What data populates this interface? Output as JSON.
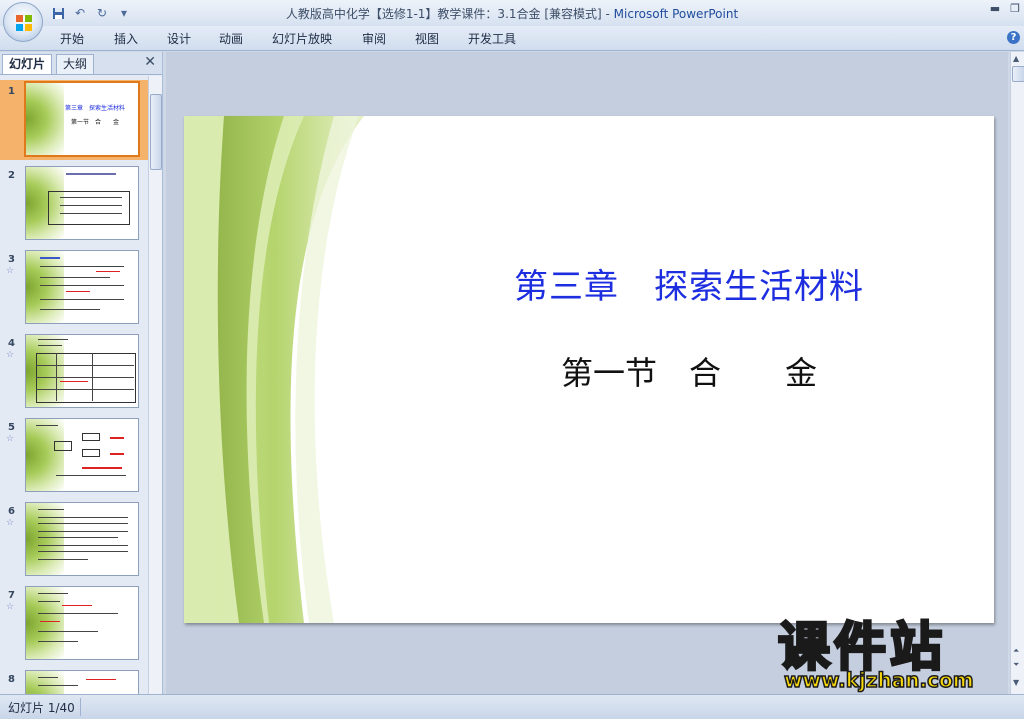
{
  "window": {
    "title": "人教版高中化学【选修1-1】教学课件：3.1合金 [兼容模式]",
    "separator": " - ",
    "app_name": "Microsoft PowerPoint"
  },
  "ribbon": {
    "tabs": [
      "开始",
      "插入",
      "设计",
      "动画",
      "幻灯片放映",
      "审阅",
      "视图",
      "开发工具"
    ]
  },
  "left_pane": {
    "tabs": [
      "幻灯片",
      "大纲"
    ],
    "active_tab": "幻灯片",
    "slides": [
      {
        "number": "1",
        "selected": true
      },
      {
        "number": "2",
        "selected": false
      },
      {
        "number": "3",
        "selected": false
      },
      {
        "number": "4",
        "selected": false
      },
      {
        "number": "5",
        "selected": false
      },
      {
        "number": "6",
        "selected": false
      },
      {
        "number": "7",
        "selected": false
      },
      {
        "number": "8",
        "selected": false
      }
    ]
  },
  "slide": {
    "title": "第三章　探索生活材料",
    "subtitle": "第一节　合　　金",
    "thumb_title": "第三章　探索生活材料",
    "thumb_sub": "第一节　合　　金",
    "title_color": "#1d2de0"
  },
  "status": {
    "slide_counter": "幻灯片 1/40"
  },
  "watermark": {
    "text": "课件站",
    "url": "www.kjzhan.com"
  },
  "colors": {
    "accent": "#e0791b",
    "ribbon": "#d1ddee",
    "slide_green": "#a7cb59"
  }
}
